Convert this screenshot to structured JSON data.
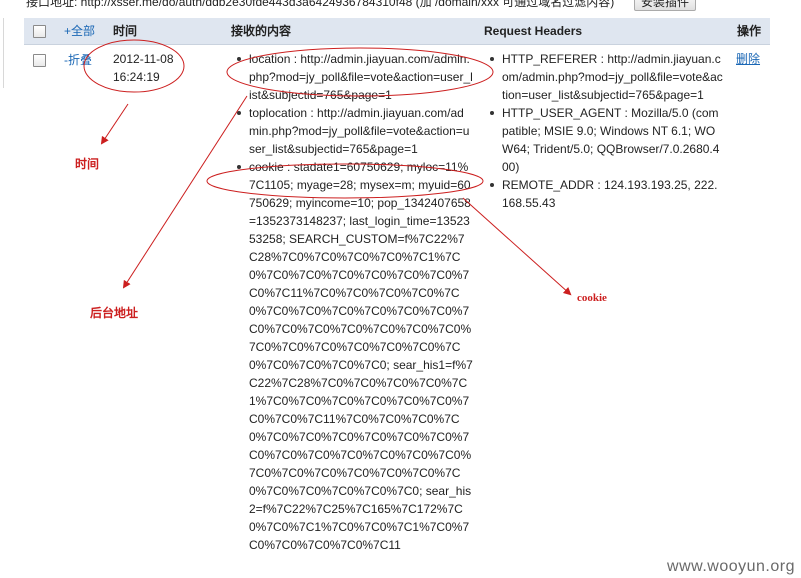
{
  "topbar": {
    "api_text": "接口地址: http://xsser.me/do/auth/ddb2e30fde443d3a6424936784310f48 (加 /domain/xxx 可通过域名过滤内容)",
    "install_button": "安装插件"
  },
  "table": {
    "headers": {
      "all": "+全部",
      "time": "时间",
      "content": "接收的内容",
      "request_headers": "Request Headers",
      "actions": "操作"
    },
    "row": {
      "toggle": "-折叠",
      "date": "2012-11-08",
      "time": "16:24:19",
      "content": [
        "location : http://admin.jiayuan.com/admin.php?mod=jy_poll&file=vote&action=user_list&subjectid=765&page=1",
        "toplocation : http://admin.jiayuan.com/admin.php?mod=jy_poll&file=vote&action=user_list&subjectid=765&page=1",
        "cookie : stadate1=60750629; myloc=11%7C1105; myage=28; mysex=m; myuid=60750629; myincome=10; pop_1342407658=1352373148237; last_login_time=1352353258; SEARCH_CUSTOM=f%7C22%7C28%7C0%7C0%7C0%7C0%7C1%7C0%7C0%7C0%7C0%7C0%7C0%7C0%7C0%7C11%7C0%7C0%7C0%7C0%7C0%7C0%7C0%7C0%7C0%7C0%7C0%7C0%7C0%7C0%7C0%7C0%7C0%7C0%7C0%7C0%7C0%7C0%7C0%7C0%7C0%7C0%7C0%7C0%7C0; sear_his1=f%7C22%7C28%7C0%7C0%7C0%7C0%7C1%7C0%7C0%7C0%7C0%7C0%7C0%7C0%7C0%7C11%7C0%7C0%7C0%7C0%7C0%7C0%7C0%7C0%7C0%7C0%7C0%7C0%7C0%7C0%7C0%7C0%7C0%7C0%7C0%7C0%7C0%7C0%7C0%7C0%7C0%7C0%7C0%7C0%7C0; sear_his2=f%7C22%7C25%7C165%7C172%7C0%7C0%7C1%7C0%7C0%7C1%7C0%7C0%7C0%7C0%7C0%7C11"
      ],
      "headers": [
        "HTTP_REFERER : http://admin.jiayuan.com/admin.php?mod=jy_poll&file=vote&action=user_list&subjectid=765&page=1",
        "HTTP_USER_AGENT : Mozilla/5.0 (compatible; MSIE 9.0; Windows NT 6.1; WOW64; Trident/5.0; QQBrowser/7.0.2680.400)",
        "REMOTE_ADDR : 124.193.193.25, 222.168.55.43"
      ],
      "delete": "删除"
    }
  },
  "annotations": {
    "time": "时间",
    "backend": "后台地址",
    "cookie": "cookie"
  },
  "watermark": "www.wooyun.org",
  "colors": {
    "header_bg": "#dfe6f0",
    "link": "#1a67b5",
    "annotation": "#cc1f1f"
  }
}
